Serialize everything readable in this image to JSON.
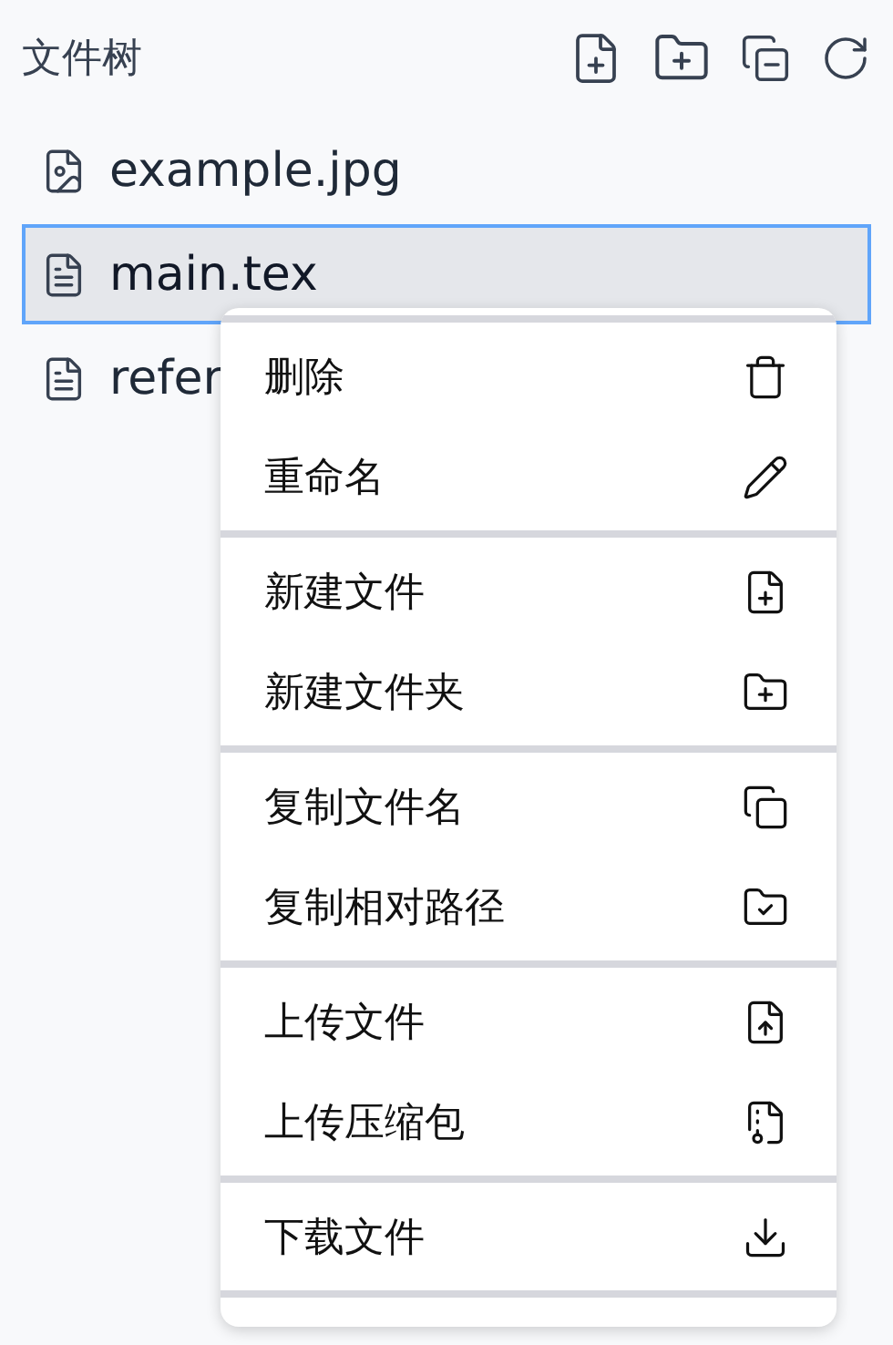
{
  "panel": {
    "title": "文件树"
  },
  "files": [
    {
      "name": "example.jpg",
      "kind": "image",
      "selected": false
    },
    {
      "name": "main.tex",
      "kind": "text",
      "selected": true
    },
    {
      "name": "refer",
      "kind": "text",
      "selected": false
    }
  ],
  "context_menu": {
    "groups": [
      {
        "items": [
          {
            "label": "删除",
            "kind": "delete"
          },
          {
            "label": "重命名",
            "kind": "rename"
          }
        ]
      },
      {
        "items": [
          {
            "label": "新建文件",
            "kind": "new-file"
          },
          {
            "label": "新建文件夹",
            "kind": "new-folder"
          }
        ]
      },
      {
        "items": [
          {
            "label": "复制文件名",
            "kind": "copy-name"
          },
          {
            "label": "复制相对路径",
            "kind": "copy-path"
          }
        ]
      },
      {
        "items": [
          {
            "label": "上传文件",
            "kind": "upload-file"
          },
          {
            "label": "上传压缩包",
            "kind": "upload-zip"
          }
        ]
      },
      {
        "items": [
          {
            "label": "下载文件",
            "kind": "download"
          }
        ]
      }
    ]
  }
}
